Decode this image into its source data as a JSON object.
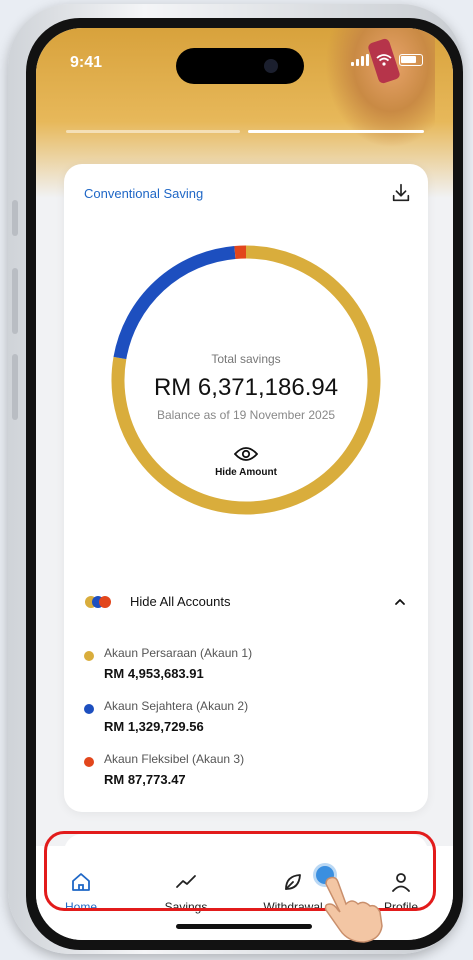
{
  "status": {
    "time": "9:41"
  },
  "card": {
    "title": "Conventional Saving",
    "total_label": "Total savings",
    "total_value": "RM 6,371,186.94",
    "balance_date": "Balance as of 19 November 2025",
    "hide_amount_label": "Hide Amount",
    "accounts_toggle_label": "Hide All Accounts",
    "accounts": [
      {
        "name": "Akaun Persaraan (Akaun 1)",
        "amount": "RM 4,953,683.91",
        "color": "#d9ad3c",
        "value": 4953683.91
      },
      {
        "name": "Akaun Sejahtera (Akaun 2)",
        "amount": "RM 1,329,729.56",
        "color": "#1d4fbf",
        "value": 1329729.56
      },
      {
        "name": "Akaun Fleksibel (Akaun 3)",
        "amount": "RM 87,773.47",
        "color": "#e2461c",
        "value": 87773.47
      }
    ]
  },
  "tabs": [
    {
      "label": "Home",
      "icon": "home-icon",
      "active": true
    },
    {
      "label": "Savings",
      "icon": "trend-line-icon",
      "active": false
    },
    {
      "label": "Withdrawal",
      "icon": "leaf-icon",
      "active": false
    },
    {
      "label": "Profile",
      "icon": "profile-icon",
      "active": false
    }
  ],
  "colors": {
    "accent_blue": "#1f67c6",
    "highlight_red": "#e21b1b",
    "gold": "#d9ad3c"
  }
}
